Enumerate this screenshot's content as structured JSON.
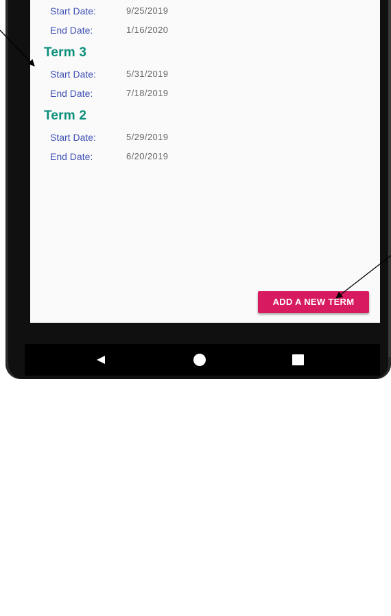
{
  "terms": [
    {
      "title": "",
      "start_label": "Start Date:",
      "start_value": "9/25/2019",
      "end_label": "End Date:",
      "end_value": "1/16/2020"
    },
    {
      "title": "Term 3",
      "start_label": "Start Date:",
      "start_value": "5/31/2019",
      "end_label": "End Date:",
      "end_value": "7/18/2019"
    },
    {
      "title": "Term 2",
      "start_label": "Start Date:",
      "start_value": "5/29/2019",
      "end_label": "End Date:",
      "end_value": "6/20/2019"
    }
  ],
  "add_button": {
    "label": "ADD A NEW TERM"
  },
  "nav": {
    "back_icon": "back-triangle-icon",
    "home_icon": "home-circle-icon",
    "recents_icon": "recents-square-icon"
  },
  "colors": {
    "term_title": "#0a8f7a",
    "date_label": "#3f51b5",
    "date_value": "#666666",
    "accent_button": "#d81b60",
    "screen_bg": "#fafafa",
    "phone_frame": "#101010"
  }
}
